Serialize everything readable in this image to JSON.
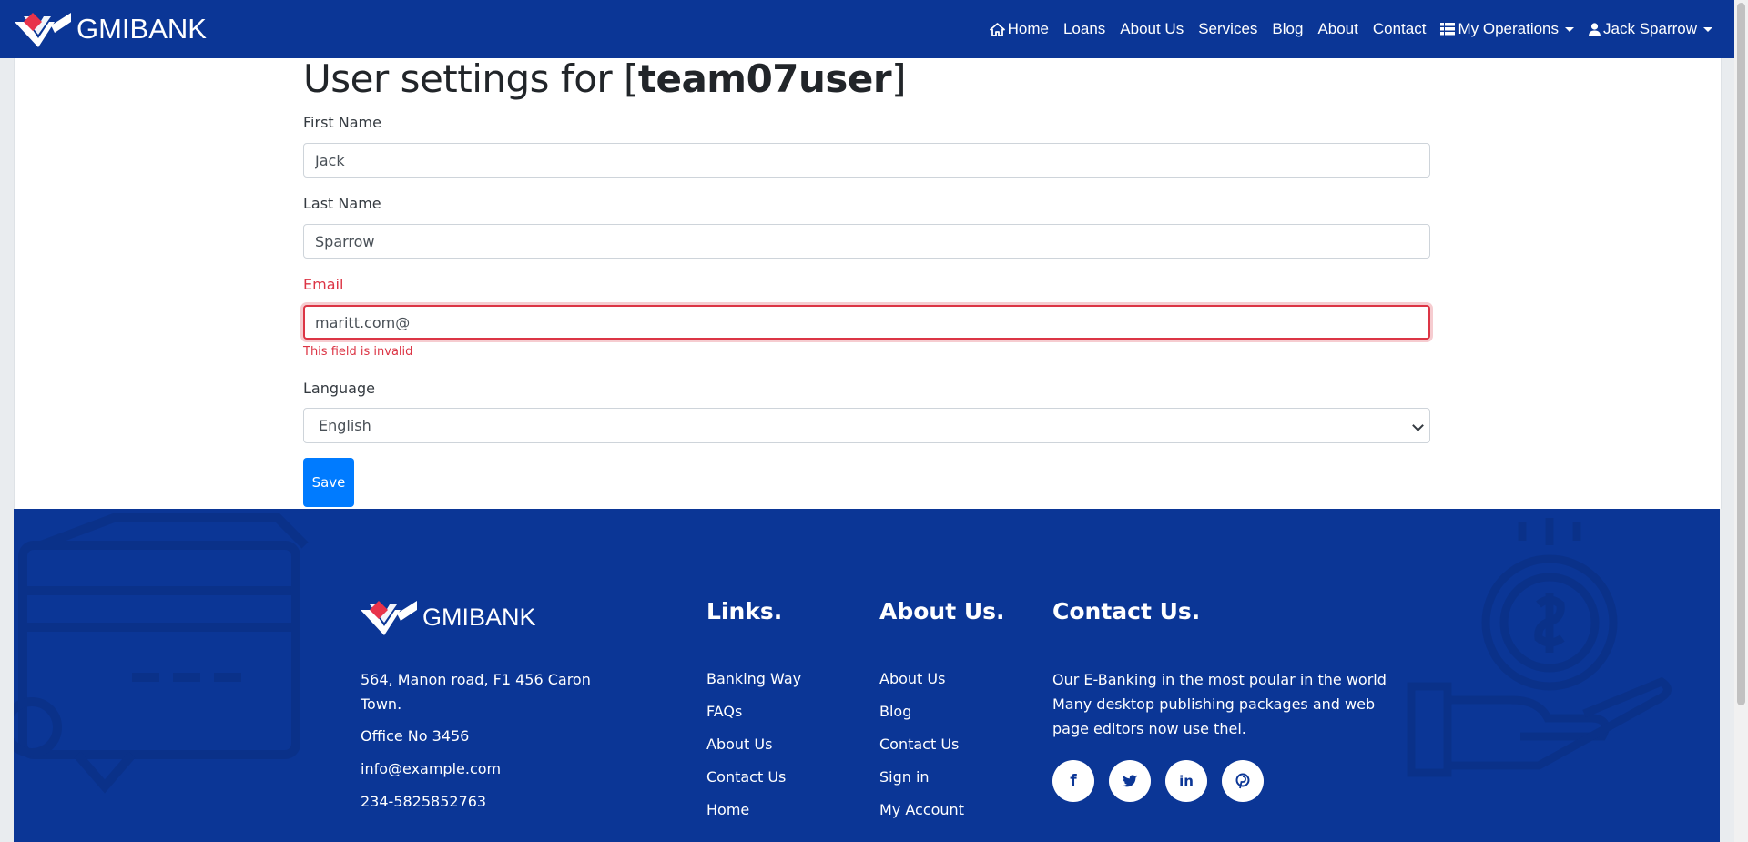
{
  "navbar": {
    "brand": "GMIBANK",
    "items": [
      {
        "label": "Home"
      },
      {
        "label": "Loans"
      },
      {
        "label": "About Us"
      },
      {
        "label": "Services"
      },
      {
        "label": "Blog"
      },
      {
        "label": "About"
      },
      {
        "label": "Contact"
      },
      {
        "label": "My Operations"
      },
      {
        "label": "Jack Sparrow"
      }
    ]
  },
  "settings": {
    "title_prefix": "User settings for [",
    "username": "team07user",
    "title_suffix": "]",
    "first_name_label": "First Name",
    "first_name_value": "Jack",
    "last_name_label": "Last Name",
    "last_name_value": "Sparrow",
    "email_label": "Email",
    "email_value": "maritt.com@",
    "email_error": "This field is invalid",
    "language_label": "Language",
    "language_value": "English",
    "save_label": "Save"
  },
  "footer": {
    "brand": "GMIBANK",
    "address_line1": "564, Manon road, F1 456 Caron",
    "address_line2": "Town.",
    "office": "Office No 3456",
    "email": "info@example.com",
    "phone": "234-5825852763",
    "links_title": "Links.",
    "links": [
      "Banking Way",
      "FAQs",
      "About Us",
      "Contact Us",
      "Home"
    ],
    "about_title": "About Us.",
    "about_links": [
      "About Us",
      "Blog",
      "Contact Us",
      "Sign in",
      "My Account"
    ],
    "contact_title": "Contact Us.",
    "contact_text_line1": "Our E-Banking in the most poular in the world",
    "contact_text_line2": "Many desktop publishing packages and web",
    "contact_text_line3": "page editors now use thei.",
    "social": [
      "f",
      "t",
      "in",
      "p"
    ]
  },
  "colors": {
    "navbar_bg": "#0b3696",
    "primary_button": "#007bff",
    "invalid": "#dc3545",
    "logo_red": "#e8334a"
  },
  "icons": [
    "gmibank-logo-icon",
    "home-icon",
    "table-icon",
    "user-icon",
    "caret-down-icon",
    "select-chevron-icon",
    "facebook-icon",
    "twitter-icon",
    "linkedin-icon",
    "pinterest-icon"
  ]
}
